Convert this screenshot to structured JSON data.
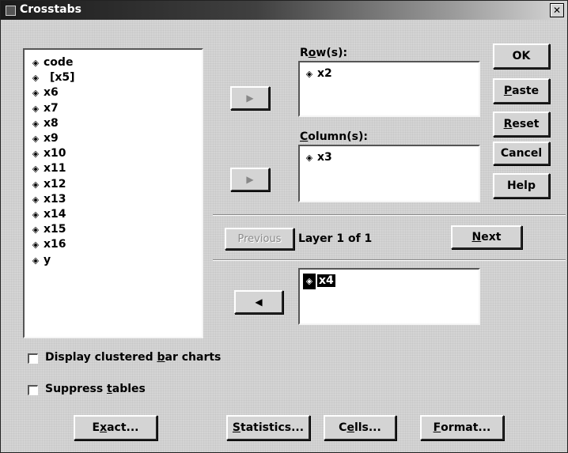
{
  "window": {
    "title": "Crosstabs"
  },
  "source_vars": [
    {
      "label": "code"
    },
    {
      "label": "[x5]"
    },
    {
      "label": "x6"
    },
    {
      "label": "x7"
    },
    {
      "label": "x8"
    },
    {
      "label": "x9"
    },
    {
      "label": "x10"
    },
    {
      "label": "x11"
    },
    {
      "label": "x12"
    },
    {
      "label": "x13"
    },
    {
      "label": "x14"
    },
    {
      "label": "x15"
    },
    {
      "label": "x16"
    },
    {
      "label": "y"
    }
  ],
  "rows": {
    "label_prefix": "R",
    "label_u": "o",
    "label_suffix": "w(s):",
    "items": [
      "x2"
    ]
  },
  "columns": {
    "label_u": "C",
    "label_suffix": "olumn(s):",
    "items": [
      "x3"
    ]
  },
  "layer": {
    "previous": "Previous",
    "text": "Layer 1 of 1",
    "next_u": "N",
    "next_rest": "ext",
    "items": [
      "x4"
    ]
  },
  "side_buttons": {
    "ok": "OK",
    "paste_u": "P",
    "paste_rest": "aste",
    "reset_u": "R",
    "reset_rest": "eset",
    "cancel": "Cancel",
    "help": "Help"
  },
  "options": {
    "clustered_pre": "Display clustered ",
    "clustered_u": "b",
    "clustered_post": "ar charts",
    "suppress_pre": "Suppress ",
    "suppress_u": "t",
    "suppress_post": "ables"
  },
  "bottom_buttons": {
    "exact_pre": "E",
    "exact_u": "x",
    "exact_post": "act...",
    "statistics_u": "S",
    "statistics_rest": "tatistics...",
    "cells_pre": "C",
    "cells_u": "e",
    "cells_post": "lls...",
    "format_u": "F",
    "format_rest": "ormat..."
  },
  "icons": {
    "variable": "variable-diamond-icon",
    "move_right": "arrow-right-icon",
    "move_left": "arrow-left-icon",
    "close": "close-icon"
  }
}
